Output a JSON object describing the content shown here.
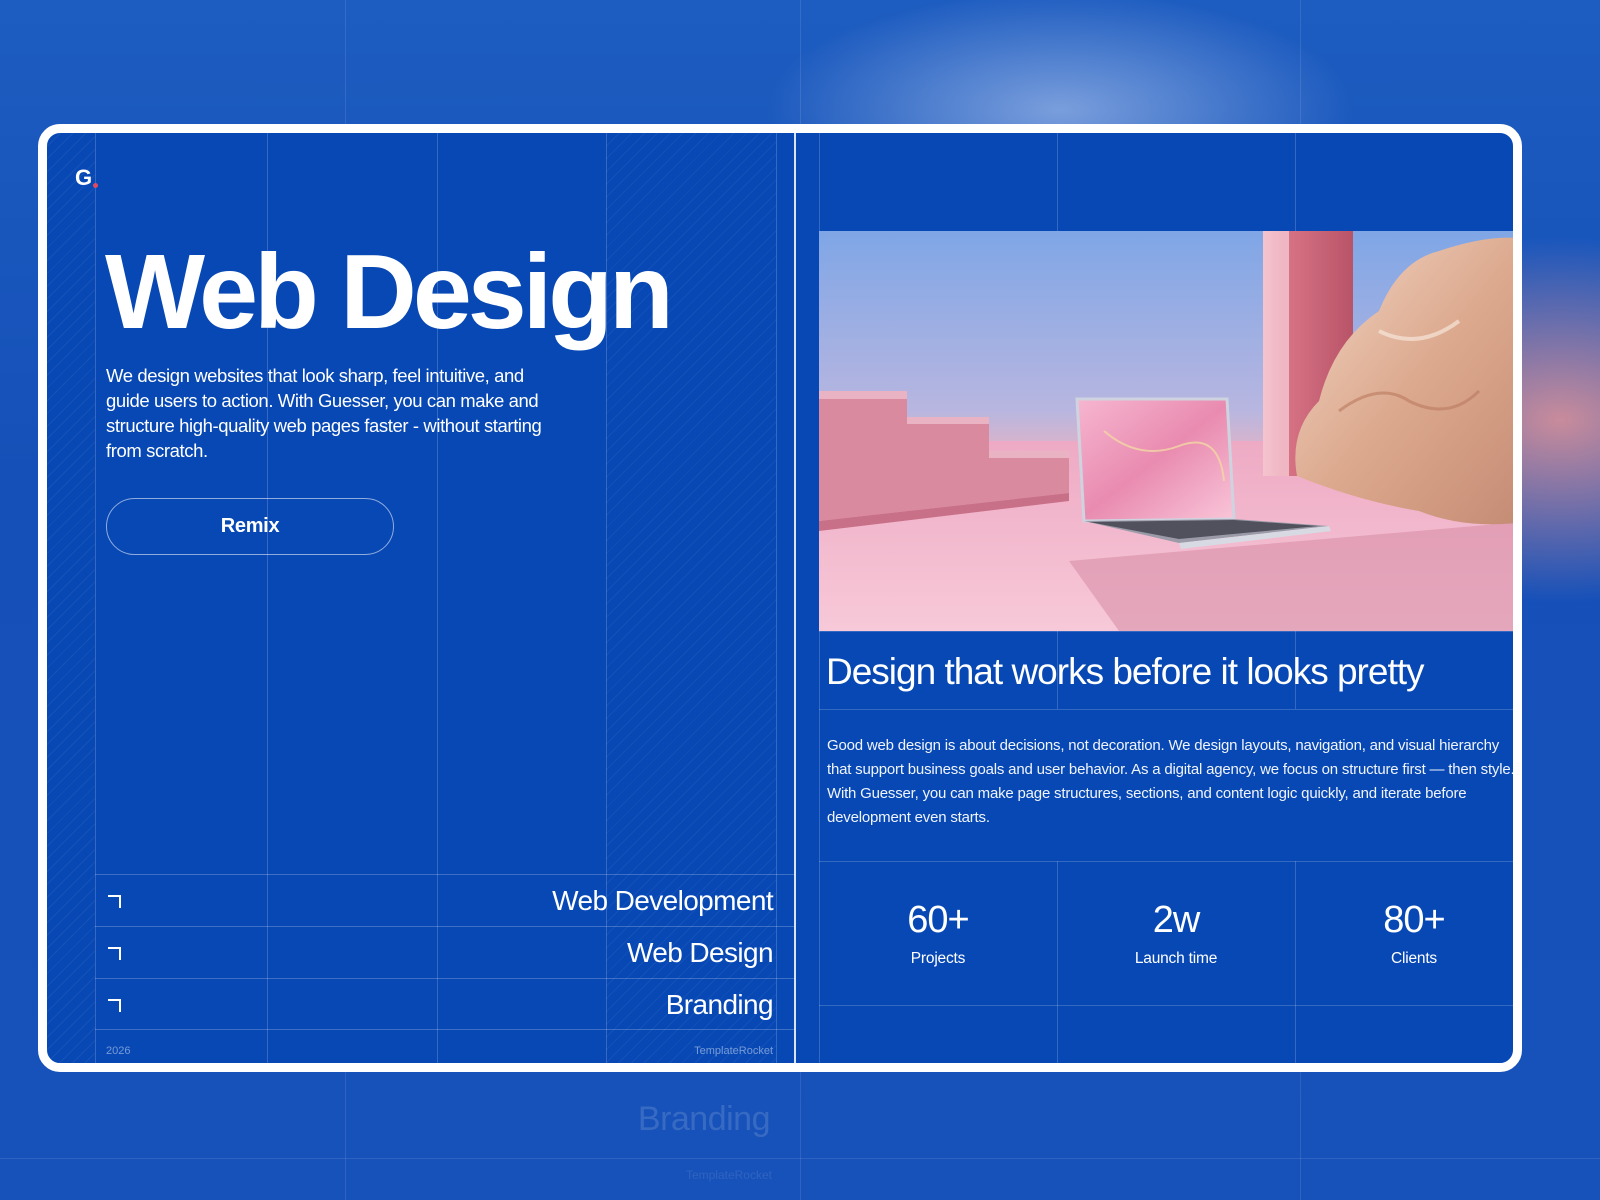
{
  "colors": {
    "accent_blue": "#0748b4",
    "frame": "#ffffff",
    "logo_dot": "#e14a5e"
  },
  "logo": {
    "text": "G"
  },
  "hero": {
    "title": "Web Design",
    "description": "We design websites that look sharp, feel intuitive, and guide users to action. With Guesser, you can make and structure high-quality web pages faster - without starting from scratch.",
    "cta_label": "Remix"
  },
  "services": [
    {
      "label": "Web Development",
      "icon": "corner-arrow-icon"
    },
    {
      "label": "Web Design",
      "icon": "corner-arrow-icon"
    },
    {
      "label": "Branding",
      "icon": "corner-arrow-icon"
    }
  ],
  "footer": {
    "year": "2026",
    "brand": "TemplateRocket"
  },
  "right": {
    "headline": "Design that works before it looks pretty",
    "body": "Good web design is about decisions, not decoration. We design layouts, navigation, and visual hierarchy that support business goals and user behavior. As a digital agency, we focus on structure first — then style. With Guesser, you can make page structures, sections, and content logic quickly, and iterate before development even starts.",
    "stats": [
      {
        "value": "60+",
        "label": "Projects"
      },
      {
        "value": "2w",
        "label": "Launch time"
      },
      {
        "value": "80+",
        "label": "Clients"
      }
    ]
  },
  "menu": {
    "icon": "hamburger-menu-icon"
  },
  "background_ghost": {
    "service": "Branding",
    "brand": "TemplateRocket"
  }
}
